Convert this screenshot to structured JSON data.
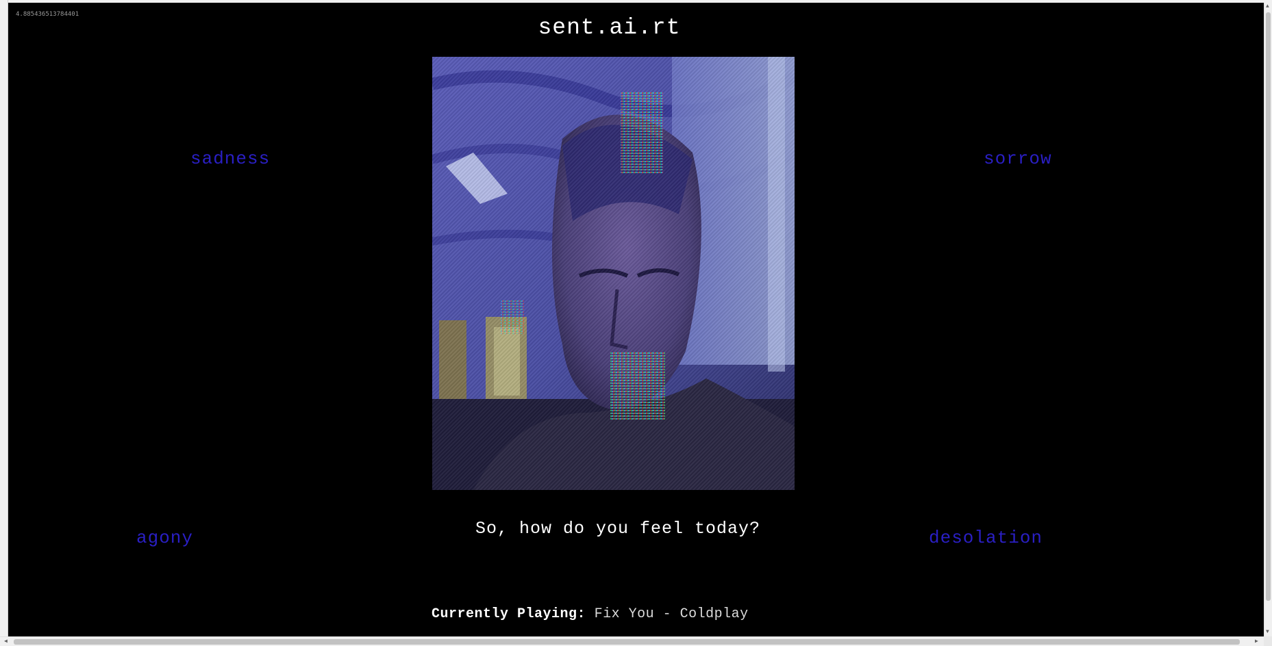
{
  "app": {
    "title": "sent.ai.rt",
    "fps_readout": "4.885436513784401"
  },
  "emotions": {
    "top_left": "sadness",
    "top_right": "sorrow",
    "bottom_left": "agony",
    "bottom_right": "desolation",
    "color": "#2a1fc4"
  },
  "prompt": {
    "question": "So, how do you feel today?"
  },
  "player": {
    "label": "Currently Playing:",
    "track": "Fix You - Coldplay"
  },
  "colors": {
    "background": "#000000",
    "text": "#ffffff",
    "camera_tint": "#3d3f88"
  },
  "icons": {
    "scroll_up": "scroll-up-icon",
    "scroll_down": "scroll-down-icon",
    "scroll_left": "scroll-left-icon",
    "scroll_right": "scroll-right-icon"
  }
}
